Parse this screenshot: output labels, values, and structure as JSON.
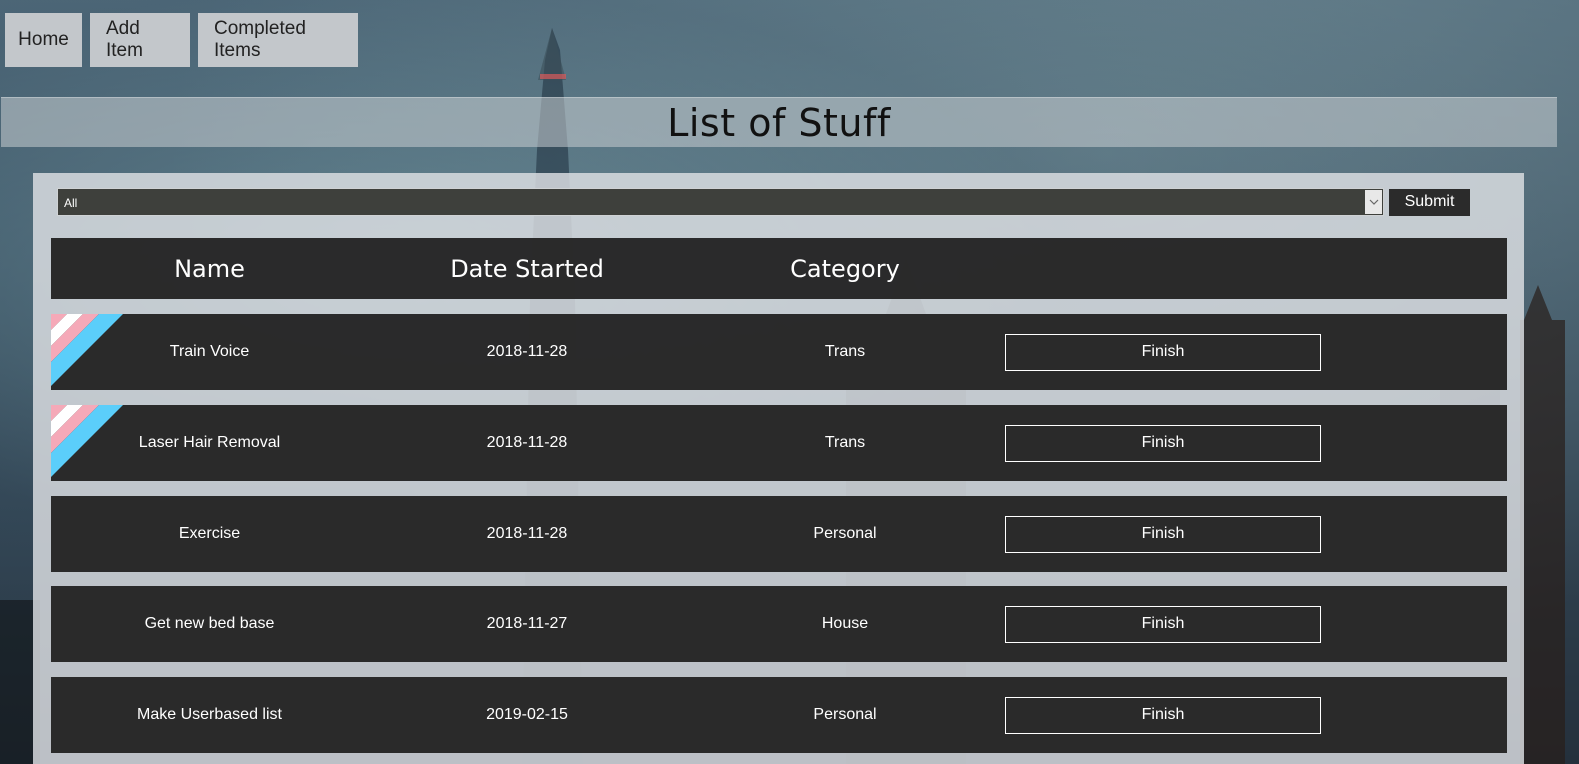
{
  "nav": {
    "home": "Home",
    "add_item": "Add Item",
    "completed_items": "Completed Items"
  },
  "page_title": "List of Stuff",
  "filter": {
    "selected": "All",
    "submit_label": "Submit"
  },
  "table": {
    "columns": [
      "Name",
      "Date Started",
      "Category"
    ],
    "rows": [
      {
        "name": "Train Voice",
        "date": "2018-11-28",
        "category": "Trans",
        "action": "Finish",
        "flag": "trans-flag-icon"
      },
      {
        "name": "Laser Hair Removal",
        "date": "2018-11-28",
        "category": "Trans",
        "action": "Finish",
        "flag": "trans-flag-icon"
      },
      {
        "name": "Exercise",
        "date": "2018-11-28",
        "category": "Personal",
        "action": "Finish"
      },
      {
        "name": "Get new bed base",
        "date": "2018-11-27",
        "category": "House",
        "action": "Finish"
      },
      {
        "name": "Make Userbased list",
        "date": "2019-02-15",
        "category": "Personal",
        "action": "Finish"
      }
    ]
  },
  "colors": {
    "flag_blue": "#5bcefa",
    "flag_pink": "#f5a9b8",
    "flag_white": "#ffffff"
  }
}
